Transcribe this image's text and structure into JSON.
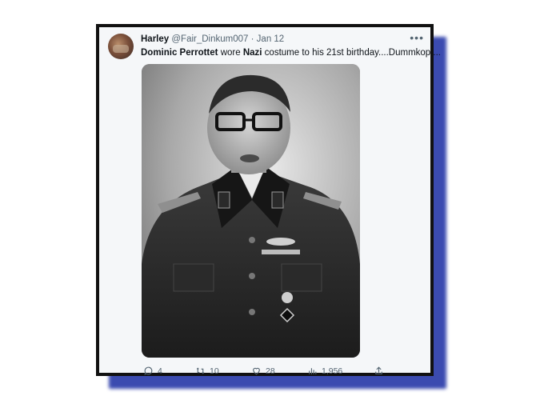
{
  "tweet": {
    "display_name": "Harley",
    "handle": "@Fair_Dinkum007",
    "separator": "·",
    "date": "Jan 12",
    "more_icon": "more-horizontal-icon",
    "text_parts": {
      "part1": "Dominic Perrottet",
      "part2": " wore ",
      "part3": "Nazi",
      "part4": " costume to his 21st birthday....Dummkop...."
    },
    "media_description_icon": "photo",
    "actions": {
      "replies": "4",
      "retweets": "10",
      "likes": "28",
      "views": "1,956"
    }
  },
  "colors": {
    "frame": "#111111",
    "shadow": "#3b4bb0",
    "card_bg": "#f5f7f9",
    "secondary_text": "#536471",
    "primary_text": "#0f1419"
  }
}
